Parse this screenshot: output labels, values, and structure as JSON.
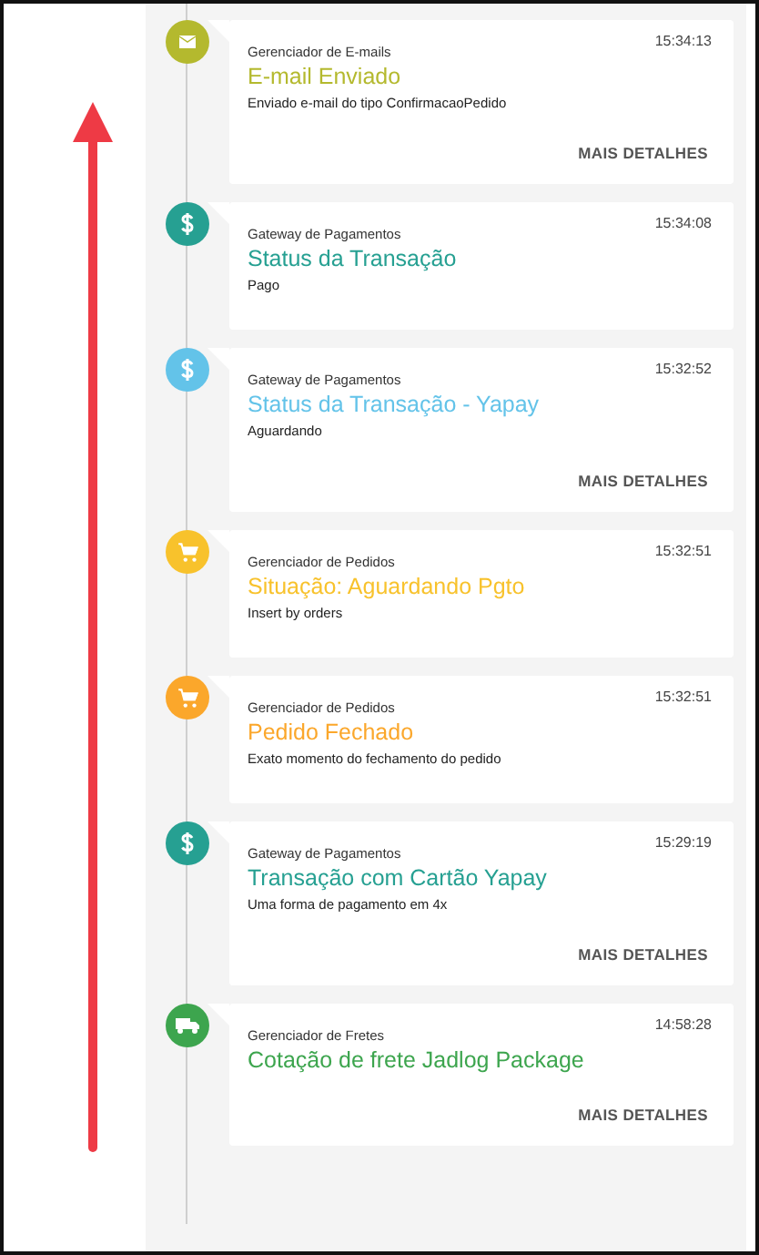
{
  "events": [
    {
      "kind": "mail",
      "color": "#b4b92e",
      "source": "Gerenciador de E-mails",
      "title": "E-mail Enviado",
      "description": "Enviado e-mail do tipo ConfirmacaoPedido",
      "time": "15:34:13",
      "action": "MAIS DETALHES"
    },
    {
      "kind": "money",
      "color": "#26a092",
      "source": "Gateway de Pagamentos",
      "title": "Status da Transação",
      "description": "Pago",
      "time": "15:34:08"
    },
    {
      "kind": "money",
      "color": "#63c3e9",
      "source": "Gateway de Pagamentos",
      "title": "Status da Transação - Yapay",
      "description": "Aguardando",
      "time": "15:32:52",
      "action": "MAIS DETALHES"
    },
    {
      "kind": "cart",
      "color": "#f8c22c",
      "source": "Gerenciador de Pedidos",
      "title": "Situação: Aguardando Pgto",
      "description": "Insert by orders",
      "time": "15:32:51"
    },
    {
      "kind": "cart",
      "color": "#fba72b",
      "source": "Gerenciador de Pedidos",
      "title": "Pedido Fechado",
      "description": "Exato momento do fechamento do pedido",
      "time": "15:32:51"
    },
    {
      "kind": "money",
      "color": "#26a092",
      "source": "Gateway de Pagamentos",
      "title": "Transação com Cartão Yapay",
      "description": "Uma forma de pagamento em 4x",
      "time": "15:29:19",
      "action": "MAIS DETALHES"
    },
    {
      "kind": "truck",
      "color": "#3da54e",
      "source": "Gerenciador de Fretes",
      "title": "Cotação de frete Jadlog Package",
      "time": "14:58:28",
      "action": "MAIS DETALHES"
    }
  ]
}
